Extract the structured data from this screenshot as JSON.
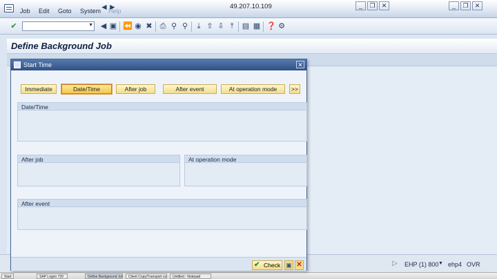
{
  "menubar": {
    "items": [
      "Job",
      "Edit",
      "Goto",
      "System",
      "Help"
    ],
    "host": "49.207.10.109"
  },
  "page": {
    "title": "Define Background Job"
  },
  "dialog": {
    "title": "Start Time",
    "buttons": [
      "Immediate",
      "Date/Time",
      "After job",
      "After event",
      "At operation mode",
      ">>"
    ],
    "active_button": "Date/Time",
    "groups": {
      "date_time": "Date/Time",
      "after_job": "After job",
      "at_operation_mode": "At operation mode",
      "after_event": "After event"
    },
    "footer": {
      "check_label": "Check"
    }
  },
  "statusbar": {
    "system": "EHP (1) 800",
    "server": "ehp4",
    "mode": "OVR"
  },
  "taskbar": {
    "items": [
      "Start",
      "SAP Logon 720",
      "Define Background Job",
      "Client Copy/Transport co...",
      "Untitled - Notepad"
    ]
  },
  "colors": {
    "accent": "#2f5188",
    "button_fill": "#f4de8a",
    "active_button_border": "#c97d2d"
  },
  "icons": [
    "enter-icon",
    "back-icon",
    "save-icon",
    "exit-icon",
    "cancel-icon",
    "print-icon",
    "find-icon",
    "help-icon"
  ]
}
